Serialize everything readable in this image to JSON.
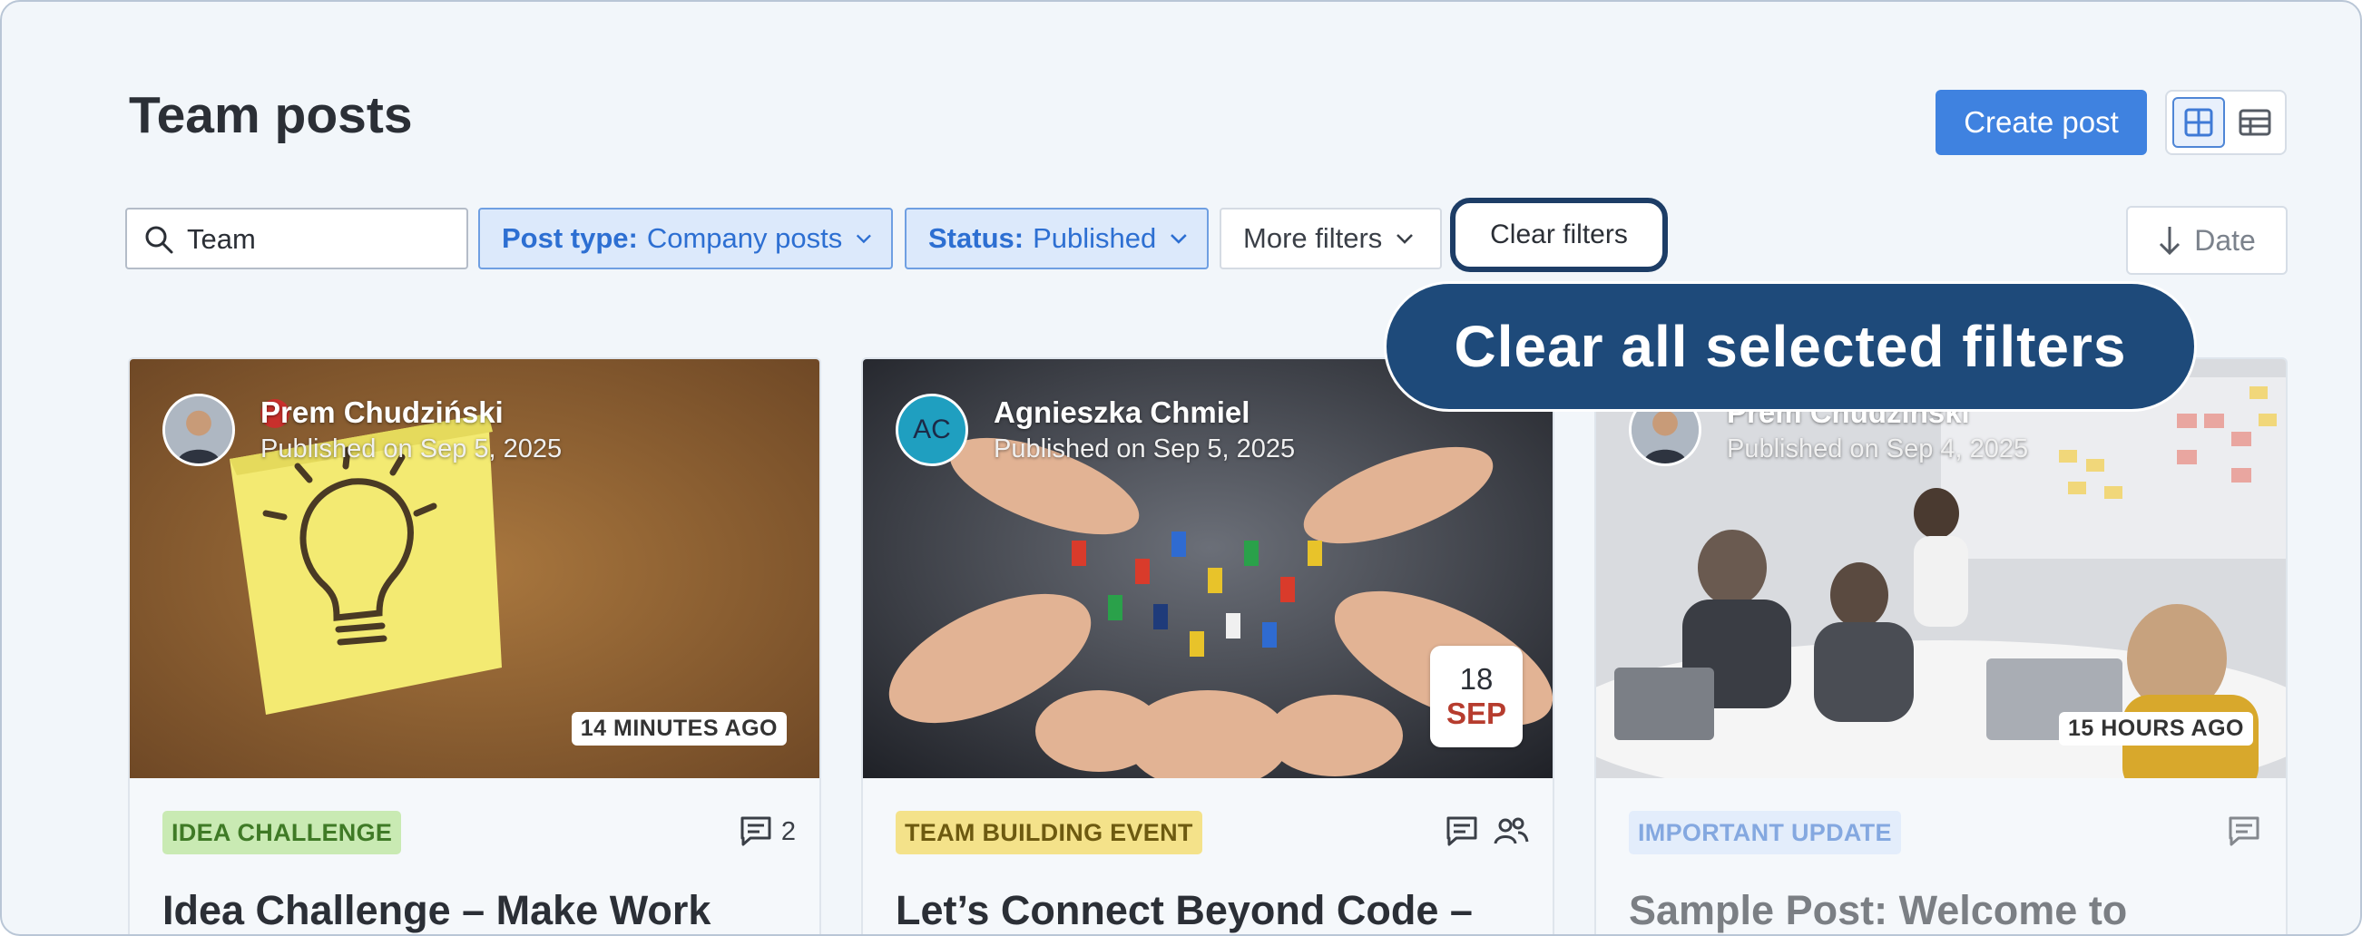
{
  "page": {
    "title": "Team posts"
  },
  "header": {
    "create_label": "Create post"
  },
  "filters": {
    "search_value": "Team",
    "post_type": {
      "label": "Post type:",
      "value": "Company posts"
    },
    "status": {
      "label": "Status:",
      "value": "Published"
    },
    "more_label": "More filters",
    "clear_label": "Clear filters",
    "sort_label": "Date"
  },
  "tooltip": {
    "text": "Clear all selected filters"
  },
  "posts": [
    {
      "author": "Prem Chudziński",
      "published": "Published on Sep 5, 2025",
      "badge": "14 MINUTES AGO",
      "tag": "IDEA CHALLENGE",
      "comments": "2",
      "title": "Idea Challenge – Make Work"
    },
    {
      "author": "Agnieszka Chmiel",
      "initials": "AC",
      "published": "Published on Sep 5, 2025",
      "event_day": "18",
      "event_month": "SEP",
      "tag": "TEAM BUILDING EVENT",
      "title": "Let’s Connect Beyond Code –"
    },
    {
      "author": "Prem Chudziński",
      "published": "Published on Sep 4, 2025",
      "badge": "15 HOURS AGO",
      "tag": "IMPORTANT UPDATE",
      "title": "Sample Post: Welcome to"
    }
  ],
  "colors": {
    "primary": "#3f82e0",
    "tooltip_bg": "#1e4a7a",
    "clear_border": "#1d3d66"
  },
  "icons": [
    "search-icon",
    "chevron-down-icon",
    "grid-view-icon",
    "table-view-icon",
    "arrow-down-icon",
    "comment-icon",
    "people-icon"
  ]
}
